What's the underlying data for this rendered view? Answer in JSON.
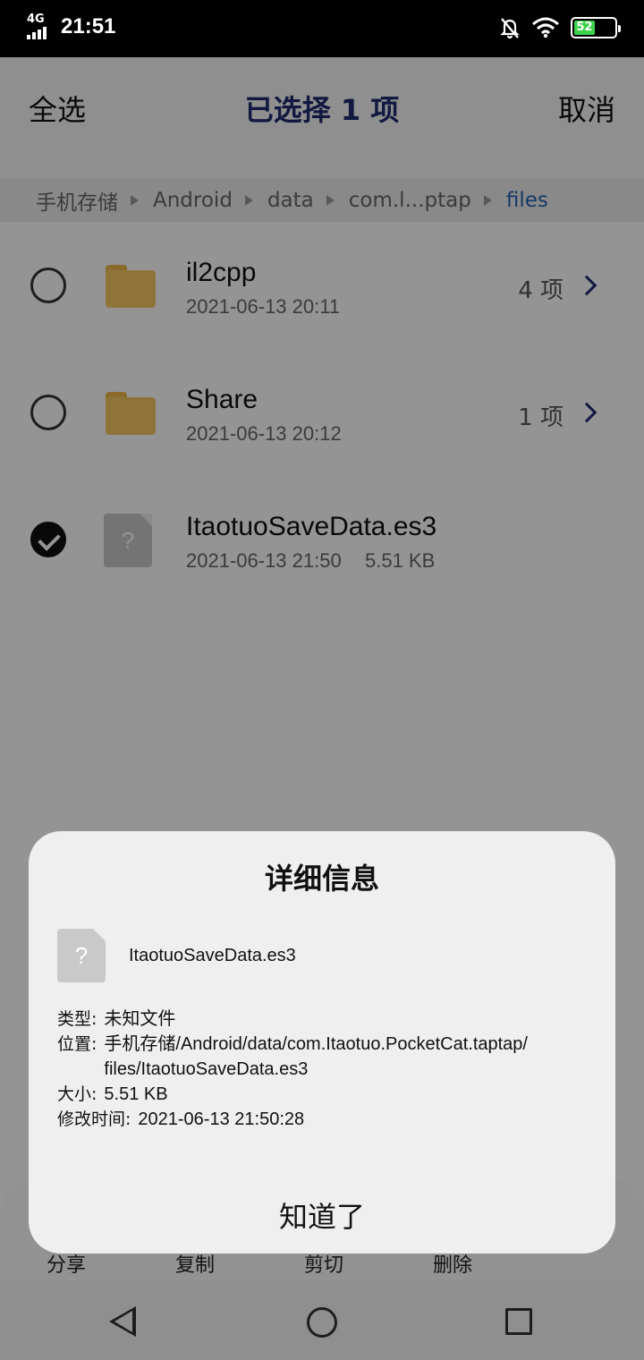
{
  "status_bar": {
    "network": "4G",
    "time": "21:51",
    "battery_level": "52",
    "battery_color": "#3ed24a"
  },
  "app_bar": {
    "select_all": "全选",
    "title": "已选择 1 项",
    "cancel": "取消",
    "title_color": "#1f2a6e"
  },
  "breadcrumb": {
    "items": [
      "手机存储",
      "Android",
      "data",
      "com.l...ptap",
      "files"
    ],
    "active_color": "#2962b6"
  },
  "files": [
    {
      "name": "il2cpp",
      "meta": "2021-06-13 20:11",
      "count": "4 项",
      "type": "folder-icon",
      "checked": false
    },
    {
      "name": "Share",
      "meta": "2021-06-13 20:12",
      "count": "1 项",
      "type": "folder-icon",
      "checked": false
    },
    {
      "name": "ItaotuoSaveData.es3",
      "date": "2021-06-13 21:50",
      "size": "5.51 KB",
      "type": "unknown-file-icon",
      "checked": true
    }
  ],
  "action_bar": {
    "items": [
      "分享",
      "复制",
      "剪切",
      "删除"
    ]
  },
  "dialog": {
    "title": "详细信息",
    "file_name": "ItaotuoSaveData.es3",
    "icon_glyph": "?",
    "type_label": "类型:",
    "type_value": "未知文件",
    "location_label": "位置:",
    "location_value_line1": "手机存储/Android/data/com.Itaotuo.PocketCat.taptap/",
    "location_value_line2": "files/ItaotuoSaveData.es3",
    "size_label": "大小:",
    "size_value": "5.51 KB",
    "modified_label": "修改时间:",
    "modified_value": "2021-06-13 21:50:28",
    "ok_button": "知道了"
  }
}
